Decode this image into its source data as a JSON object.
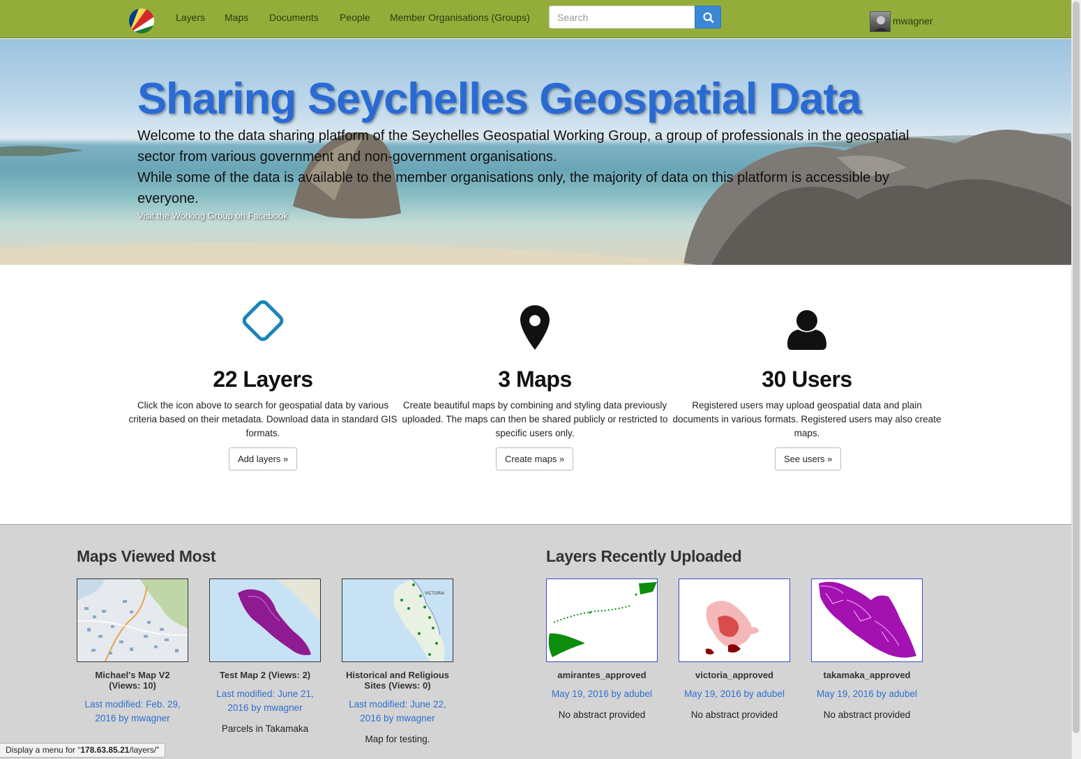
{
  "navbar": {
    "items": [
      "Layers",
      "Maps",
      "Documents",
      "People",
      "Member Organisations (Groups)"
    ],
    "search_placeholder": "Search",
    "username": "mwagner",
    "colors": {
      "bar": "#94ad3a",
      "search_button": "#3a87d6"
    }
  },
  "hero": {
    "title": "Sharing Seychelles Geospatial Data",
    "paragraph1": "Welcome to the data sharing platform of the Seychelles Geospatial Working Group, a group of professionals in the geospatial sector from various government and non-government organisations.",
    "paragraph2": "While some of the data is available to the member organisations only, the majority of data on this platform is accessible by everyone.",
    "facebook_link": "Visit the Working Group on Facebook"
  },
  "features": [
    {
      "icon": "diamond-icon",
      "title": "22 Layers",
      "description": "Click the icon above to search for geospatial data by various criteria based on their metadata. Download data in standard GIS formats.",
      "button": "Add layers »"
    },
    {
      "icon": "map-marker-icon",
      "title": "3 Maps",
      "description": "Create beautiful maps by combining and styling data previously uploaded. The maps can then be shared publicly or restricted to specific users only.",
      "button": "Create maps »"
    },
    {
      "icon": "user-icon",
      "title": "30 Users",
      "description": "Registered users may upload geospatial data and plain documents in various formats. Registered users may also create maps.",
      "button": "See users »"
    }
  ],
  "maps_viewed_most": {
    "title": "Maps Viewed Most",
    "items": [
      {
        "title": "Michael's Map V2 (Views: 10)",
        "meta": "Last modified: Feb. 29, 2016 by mwagner",
        "abstract": ""
      },
      {
        "title": "Test Map 2 (Views: 2)",
        "meta": "Last modified: June 21, 2016 by mwagner",
        "abstract": "Parcels in Takamaka"
      },
      {
        "title": "Historical and Religious Sites (Views: 0)",
        "meta": "Last modified: June 22, 2016 by mwagner",
        "abstract": "Map for testing."
      }
    ]
  },
  "layers_recently_uploaded": {
    "title": "Layers Recently Uploaded",
    "items": [
      {
        "title": "amirantes_approved",
        "meta": "May 19, 2016 by adubel",
        "abstract": "No abstract provided"
      },
      {
        "title": "victoria_approved",
        "meta": "May 19, 2016 by adubel",
        "abstract": "No abstract provided"
      },
      {
        "title": "takamaka_approved",
        "meta": "May 19, 2016 by adubel",
        "abstract": "No abstract provided"
      }
    ]
  },
  "statusbar": {
    "prefix": "Display a menu for “",
    "host": "178.63.85.21",
    "path": "/layers/”"
  }
}
